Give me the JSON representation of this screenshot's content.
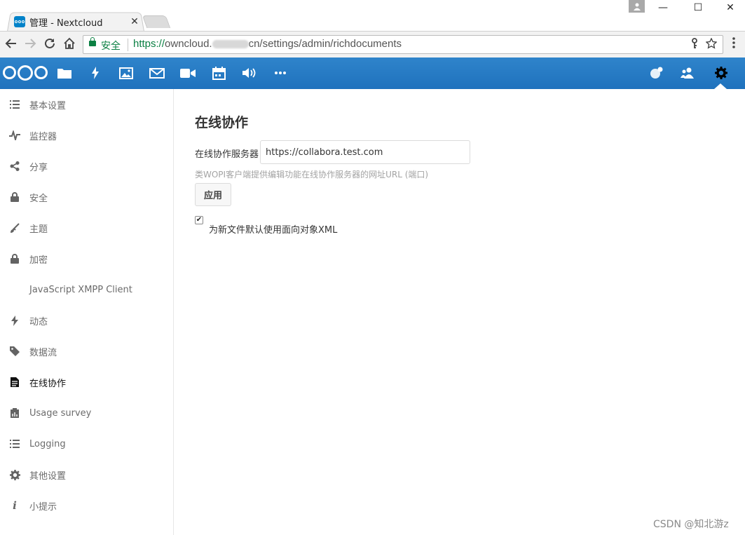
{
  "browser": {
    "tab_title": "管理 - Nextcloud",
    "tab_close": "✕",
    "win_min": "—",
    "win_max": "☐",
    "win_close": "✕",
    "secure_label": "安全",
    "url_scheme": "https://",
    "url_host_start": "owncloud.",
    "url_rest": "cn/settings/admin/richdocuments",
    "icons": [
      "back-arrow-icon",
      "forward-arrow-icon",
      "reload-icon",
      "home-icon",
      "lock-icon",
      "key-icon",
      "star-icon",
      "menu-icon"
    ]
  },
  "header": {
    "colors": {
      "background": "#1f72bd",
      "accent": "#0082c9"
    },
    "apps": [
      "files-icon",
      "activity-icon",
      "gallery-icon",
      "mail-icon",
      "video-icon",
      "calendar-icon",
      "audio-icon",
      "more-icon"
    ],
    "right": [
      "search-contacts-icon",
      "contacts-icon",
      "settings-icon"
    ]
  },
  "sidebar": {
    "items": [
      {
        "label": "基本设置",
        "icon": "list-icon"
      },
      {
        "label": "监控器",
        "icon": "pulse-icon"
      },
      {
        "label": "分享",
        "icon": "share-icon"
      },
      {
        "label": "安全",
        "icon": "lock-icon"
      },
      {
        "label": "主题",
        "icon": "brush-icon"
      },
      {
        "label": "加密",
        "icon": "lock-icon"
      },
      {
        "label": "JavaScript XMPP Client",
        "icon": ""
      },
      {
        "label": "动态",
        "icon": "activity-icon"
      },
      {
        "label": "数据流",
        "icon": "tag-icon"
      },
      {
        "label": "在线协作",
        "icon": "document-icon",
        "active": true
      },
      {
        "label": "Usage survey",
        "icon": "survey-icon"
      },
      {
        "label": "Logging",
        "icon": "list-icon"
      },
      {
        "label": "其他设置",
        "icon": "gear-icon"
      },
      {
        "label": "小提示",
        "icon": "info-icon"
      }
    ]
  },
  "main": {
    "title": "在线协作",
    "server_label": "在线协作服务器",
    "server_value": "https://collabora.test.com",
    "hint": "类WOPI客户端提供编辑功能在线协作服务器的网址URL (端口)",
    "apply_label": "应用",
    "checkbox_checked": true,
    "checkbox_mark": "✔",
    "checkbox_label": "为新文件默认使用面向对象XML"
  },
  "watermark": "CSDN @知北游z"
}
